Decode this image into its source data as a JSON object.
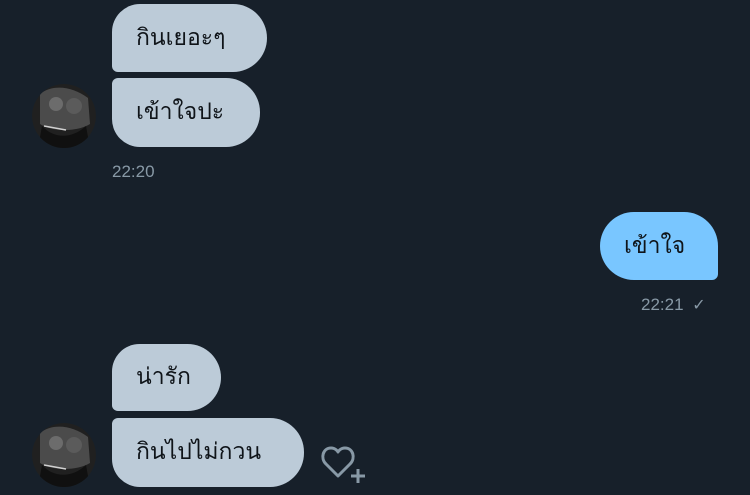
{
  "conversation": {
    "incoming_group_1": {
      "messages": [
        "กินเยอะๆ",
        "เข้าใจปะ"
      ],
      "timestamp": "22:20"
    },
    "outgoing_1": {
      "text": "เข้าใจ",
      "timestamp": "22:21",
      "status_icon": "checkmark-icon"
    },
    "incoming_group_2": {
      "messages": [
        "น่ารัก",
        "กินไปไม่กวน"
      ]
    }
  },
  "colors": {
    "background": "#17202a",
    "incoming_bubble": "#bccbd8",
    "outgoing_bubble": "#79c6ff",
    "timestamp_text": "#8899a6"
  },
  "icons": [
    "avatar",
    "checkmark-icon",
    "heart-plus-icon"
  ]
}
